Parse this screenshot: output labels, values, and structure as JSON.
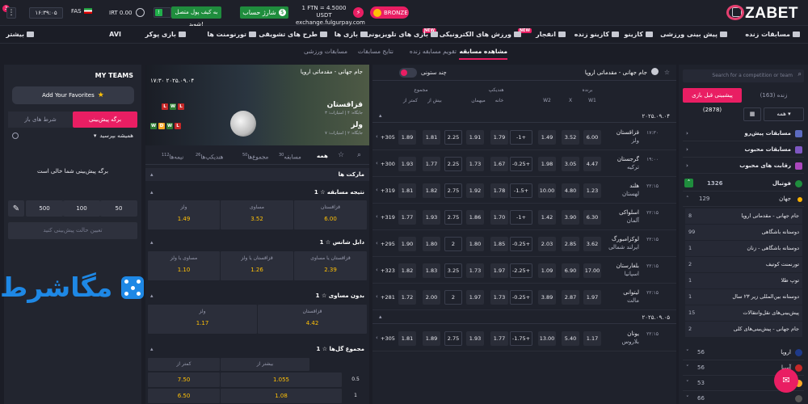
{
  "topbar": {
    "logo": "ZABET",
    "bronze": "BRONZE",
    "rate_line1": "1 FTN = 4.5000 USDT",
    "rate_line2": "exchange.fulgurpay.com",
    "wallet": "به کیف پول متصل شوید!",
    "charge": "شارژ حساب",
    "toggle_value": "",
    "balance": "IRT 0.00",
    "lang": "FAS",
    "time": "۱۶:۳۹:۰۵",
    "bell_count": "3"
  },
  "nav": {
    "items": [
      {
        "label": "مسابقات زنده"
      },
      {
        "label": "پیش بینی ورزشی"
      },
      {
        "label": "کازینو"
      },
      {
        "label": "کازینو زنده"
      },
      {
        "label": "انفجار",
        "tag": "NEW"
      },
      {
        "label": "ورزش های الکترونیکی",
        "tag": "NEW"
      },
      {
        "label": "بازی های تلویزیونی"
      },
      {
        "label": "بازی ها"
      },
      {
        "label": "طرح های تشویقی"
      },
      {
        "label": "تورنومنت ها"
      },
      {
        "label": "بازی پوکر"
      },
      {
        "label": "AVI"
      },
      {
        "label": "بیشتر"
      }
    ]
  },
  "subnav": {
    "items": [
      "مشاهده مسابقه",
      "تقویم مسابقه زنده",
      "نتایج مسابقات",
      "مسابقات ورزشی"
    ]
  },
  "betslip": {
    "title": "MY TEAMS",
    "add_fav": "Add Your Favorites",
    "tab_betslip": "برگه پیش‌بینی",
    "tab_open": "شرط های باز",
    "accept": "همیشه بپرسید",
    "empty": "برگه پیش‌بینی شما خالی است",
    "amounts": [
      "50",
      "100",
      "500"
    ],
    "stake_placeholder": "تعیین حالت پیش‌بینی کنید",
    "watermark": "مگاشرط"
  },
  "match": {
    "league": "جام جهانی - مقدماتی اروپا",
    "date": "۱۷:۳۰ ۲۰۲۵.۰۹.۰۴",
    "home": "قزاقستان",
    "home_sub": "جایگاه: ۴ | امتیازات: ۳",
    "away": "ولز",
    "away_sub": "جایگاه: ۲ | امتیازات: ۷",
    "home_form": [
      "L",
      "W",
      "L"
    ],
    "away_form": [
      "W",
      "D",
      "W",
      "L"
    ],
    "tabs": [
      {
        "label": "همه",
        "count": ""
      },
      {
        "label": "مسابقه",
        "count": "30"
      },
      {
        "label": "مجموع‌ها",
        "count": "50"
      },
      {
        "label": "هندیکپ‌ها",
        "count": "26"
      },
      {
        "label": "نیمه‌ها",
        "count": "112"
      }
    ],
    "markets_header": "مارکت ها",
    "markets": [
      {
        "title": "نتیجه مسابقه",
        "count": "1",
        "outcomes": [
          {
            "label": "قزاقستان",
            "odd": "6.00"
          },
          {
            "label": "مساوی",
            "odd": "3.52"
          },
          {
            "label": "ولز",
            "odd": "1.49"
          }
        ]
      },
      {
        "title": "دابل شانس",
        "count": "1",
        "outcomes": [
          {
            "label": "قزاقستان یا مساوی",
            "odd": "2.39"
          },
          {
            "label": "قزاقستان یا ولز",
            "odd": "1.26"
          },
          {
            "label": "مساوی یا ولز",
            "odd": "1.10"
          }
        ]
      },
      {
        "title": "بدون مساوی",
        "count": "1",
        "outcomes": [
          {
            "label": "قزاقستان",
            "odd": "4.42"
          },
          {
            "label": "ولز",
            "odd": "1.17"
          }
        ]
      },
      {
        "title": "مجموع گل‌ها",
        "count": "1",
        "outcomes": [
          {
            "label": "بیشتر از",
            "odd": "1.055"
          },
          {
            "label": "کمتر از",
            "odd": "7.50"
          }
        ],
        "line": "0.5",
        "row2": {
          "line": "1",
          "over": "1.08",
          "under": "6.50"
        }
      }
    ]
  },
  "events": {
    "league": "جام جهانی - مقدماتی اروپا",
    "columns_toggle": "چند ستونی",
    "h_winner": "برنده",
    "h_handicap": "هندیکپ",
    "h_total": "مجموع",
    "h_w1": "W1",
    "h_x": "X",
    "h_w2": "W2",
    "h_home": "خانه",
    "h_guest": "میهمان",
    "h_over": "بیش از",
    "h_under": "کمتر از",
    "dates": [
      "۲۰۲۵.۰۹.۰۴",
      "۲۰۲۵.۰۹.۰۵"
    ],
    "rows": [
      {
        "t1": "قزاقستان",
        "t2": "ولز",
        "time": "۱۷:۳۰",
        "w1": "6.00",
        "x": "3.52",
        "w2": "1.49",
        "hl": "-1+",
        "h1": "1.79",
        "h2": "1.91",
        "tl": "2.25",
        "o": "1.81",
        "u": "1.89",
        "more": "+305"
      },
      {
        "t1": "گرجستان",
        "t2": "ترکیه",
        "time": "۱۹:۰۰",
        "w1": "4.47",
        "x": "3.05",
        "w2": "1.98",
        "hl": "-0.25+",
        "h1": "1.67",
        "h2": "1.73",
        "tl": "2.25",
        "o": "1.77",
        "u": "1.93",
        "more": "+300"
      },
      {
        "t1": "هلند",
        "t2": "لهستان",
        "time": "۲۲:۱۵",
        "w1": "1.23",
        "x": "4.80",
        "w2": "10.00",
        "hl": "-1.5+",
        "h1": "1.78",
        "h2": "1.92",
        "tl": "2.75",
        "o": "1.82",
        "u": "1.81",
        "more": "+319"
      },
      {
        "t1": "اسلواکی",
        "t2": "آلمان",
        "time": "۲۲:۱۵",
        "w1": "6.30",
        "x": "3.90",
        "w2": "1.42",
        "hl": "-1+",
        "h1": "1.70",
        "h2": "1.86",
        "tl": "2.75",
        "o": "1.93",
        "u": "1.77",
        "more": "+319"
      },
      {
        "t1": "لوکزامبورگ",
        "t2": "ایرلند شمالی",
        "time": "۲۲:۱۵",
        "w1": "3.62",
        "x": "2.85",
        "w2": "2.03",
        "hl": "-0.25+",
        "h1": "1.85",
        "h2": "1.80",
        "tl": "2",
        "o": "1.80",
        "u": "1.90",
        "more": "+295"
      },
      {
        "t1": "بلغارستان",
        "t2": "اسپانیا",
        "time": "۲۲:۱۵",
        "w1": "17.00",
        "x": "6.90",
        "w2": "1.09",
        "hl": "-2.25+",
        "h1": "1.97",
        "h2": "1.73",
        "tl": "3.25",
        "o": "1.83",
        "u": "1.82",
        "more": "+323"
      },
      {
        "t1": "لیتوانی",
        "t2": "مالت",
        "time": "۲۲:۱۵",
        "w1": "1.97",
        "x": "2.87",
        "w2": "3.89",
        "hl": "-0.25+",
        "h1": "1.73",
        "h2": "1.97",
        "tl": "2",
        "o": "2.00",
        "u": "1.72",
        "more": "+281"
      },
      {
        "t1": "یونان",
        "t2": "بلاروس",
        "time": "۲۲:۱۵",
        "w1": "1.17",
        "x": "5.40",
        "w2": "13.00",
        "hl": "-1.75+",
        "h1": "1.77",
        "h2": "1.93",
        "tl": "2.75",
        "o": "1.89",
        "u": "1.81",
        "more": "+305"
      }
    ]
  },
  "sidebar": {
    "search_placeholder": "Search for a competition or team",
    "tab_pre": "پیشبینی قبل بازی (2878)",
    "tab_live": "زنده (163)",
    "select_all": "همه",
    "rows": [
      "مسابقات پیش‌رو",
      "مسابقات محبوب",
      "رقابت های محبوب"
    ],
    "sport": "فوتبال",
    "sport_count": "1326",
    "region": "جهان",
    "region_count": "129",
    "competitions": [
      {
        "name": "جام جهانی - مقدماتی اروپا",
        "count": "8"
      },
      {
        "name": "دوستانه باشگاهی",
        "count": "99"
      },
      {
        "name": "دوستانه باشگاهی - زنان",
        "count": "1"
      },
      {
        "name": "تورنمنت کوتیف",
        "count": "2"
      },
      {
        "name": "توپ طلا",
        "count": "1"
      },
      {
        "name": "دوستانه بین‌المللی زیر ۲۳ سال",
        "count": "1"
      },
      {
        "name": "پیش‌بینی‌های نقل‌وانتقالات",
        "count": "15"
      },
      {
        "name": "جام جهانی - پیش‌بینی‌های کلی",
        "count": "2"
      }
    ],
    "countries": [
      {
        "name": "اروپا",
        "count": "56"
      },
      {
        "name": "آسیا",
        "count": "56"
      },
      {
        "name": "آفریقا",
        "count": "53"
      },
      {
        "name": "",
        "count": "66"
      }
    ]
  },
  "colors": {
    "accent": "#e91e63",
    "odds": "#ffc107",
    "green": "#1f8d3d",
    "bg": "#1b1d26"
  }
}
